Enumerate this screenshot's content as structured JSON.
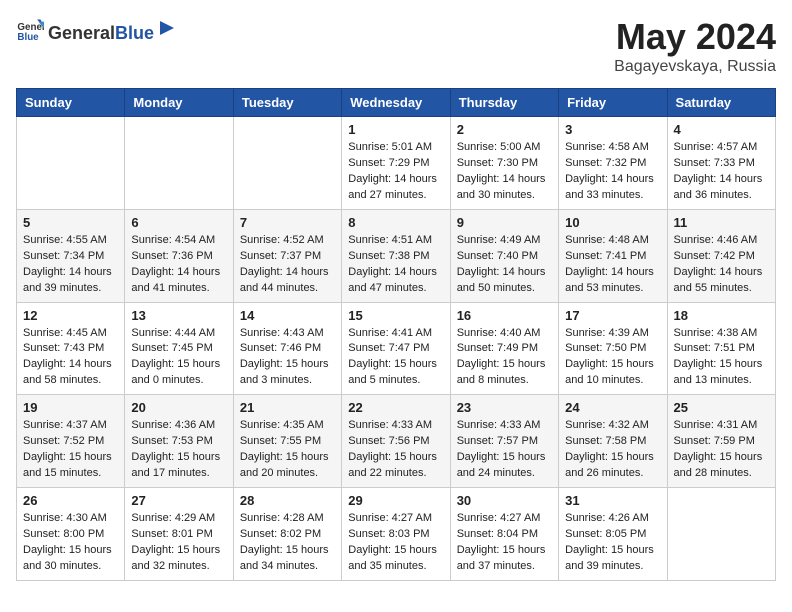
{
  "header": {
    "logo_general": "General",
    "logo_blue": "Blue",
    "title": "May 2024",
    "location": "Bagayevskaya, Russia"
  },
  "weekdays": [
    "Sunday",
    "Monday",
    "Tuesday",
    "Wednesday",
    "Thursday",
    "Friday",
    "Saturday"
  ],
  "weeks": [
    [
      {
        "day": "",
        "sunrise": "",
        "sunset": "",
        "daylight": ""
      },
      {
        "day": "",
        "sunrise": "",
        "sunset": "",
        "daylight": ""
      },
      {
        "day": "",
        "sunrise": "",
        "sunset": "",
        "daylight": ""
      },
      {
        "day": "1",
        "sunrise": "Sunrise: 5:01 AM",
        "sunset": "Sunset: 7:29 PM",
        "daylight": "Daylight: 14 hours and 27 minutes."
      },
      {
        "day": "2",
        "sunrise": "Sunrise: 5:00 AM",
        "sunset": "Sunset: 7:30 PM",
        "daylight": "Daylight: 14 hours and 30 minutes."
      },
      {
        "day": "3",
        "sunrise": "Sunrise: 4:58 AM",
        "sunset": "Sunset: 7:32 PM",
        "daylight": "Daylight: 14 hours and 33 minutes."
      },
      {
        "day": "4",
        "sunrise": "Sunrise: 4:57 AM",
        "sunset": "Sunset: 7:33 PM",
        "daylight": "Daylight: 14 hours and 36 minutes."
      }
    ],
    [
      {
        "day": "5",
        "sunrise": "Sunrise: 4:55 AM",
        "sunset": "Sunset: 7:34 PM",
        "daylight": "Daylight: 14 hours and 39 minutes."
      },
      {
        "day": "6",
        "sunrise": "Sunrise: 4:54 AM",
        "sunset": "Sunset: 7:36 PM",
        "daylight": "Daylight: 14 hours and 41 minutes."
      },
      {
        "day": "7",
        "sunrise": "Sunrise: 4:52 AM",
        "sunset": "Sunset: 7:37 PM",
        "daylight": "Daylight: 14 hours and 44 minutes."
      },
      {
        "day": "8",
        "sunrise": "Sunrise: 4:51 AM",
        "sunset": "Sunset: 7:38 PM",
        "daylight": "Daylight: 14 hours and 47 minutes."
      },
      {
        "day": "9",
        "sunrise": "Sunrise: 4:49 AM",
        "sunset": "Sunset: 7:40 PM",
        "daylight": "Daylight: 14 hours and 50 minutes."
      },
      {
        "day": "10",
        "sunrise": "Sunrise: 4:48 AM",
        "sunset": "Sunset: 7:41 PM",
        "daylight": "Daylight: 14 hours and 53 minutes."
      },
      {
        "day": "11",
        "sunrise": "Sunrise: 4:46 AM",
        "sunset": "Sunset: 7:42 PM",
        "daylight": "Daylight: 14 hours and 55 minutes."
      }
    ],
    [
      {
        "day": "12",
        "sunrise": "Sunrise: 4:45 AM",
        "sunset": "Sunset: 7:43 PM",
        "daylight": "Daylight: 14 hours and 58 minutes."
      },
      {
        "day": "13",
        "sunrise": "Sunrise: 4:44 AM",
        "sunset": "Sunset: 7:45 PM",
        "daylight": "Daylight: 15 hours and 0 minutes."
      },
      {
        "day": "14",
        "sunrise": "Sunrise: 4:43 AM",
        "sunset": "Sunset: 7:46 PM",
        "daylight": "Daylight: 15 hours and 3 minutes."
      },
      {
        "day": "15",
        "sunrise": "Sunrise: 4:41 AM",
        "sunset": "Sunset: 7:47 PM",
        "daylight": "Daylight: 15 hours and 5 minutes."
      },
      {
        "day": "16",
        "sunrise": "Sunrise: 4:40 AM",
        "sunset": "Sunset: 7:49 PM",
        "daylight": "Daylight: 15 hours and 8 minutes."
      },
      {
        "day": "17",
        "sunrise": "Sunrise: 4:39 AM",
        "sunset": "Sunset: 7:50 PM",
        "daylight": "Daylight: 15 hours and 10 minutes."
      },
      {
        "day": "18",
        "sunrise": "Sunrise: 4:38 AM",
        "sunset": "Sunset: 7:51 PM",
        "daylight": "Daylight: 15 hours and 13 minutes."
      }
    ],
    [
      {
        "day": "19",
        "sunrise": "Sunrise: 4:37 AM",
        "sunset": "Sunset: 7:52 PM",
        "daylight": "Daylight: 15 hours and 15 minutes."
      },
      {
        "day": "20",
        "sunrise": "Sunrise: 4:36 AM",
        "sunset": "Sunset: 7:53 PM",
        "daylight": "Daylight: 15 hours and 17 minutes."
      },
      {
        "day": "21",
        "sunrise": "Sunrise: 4:35 AM",
        "sunset": "Sunset: 7:55 PM",
        "daylight": "Daylight: 15 hours and 20 minutes."
      },
      {
        "day": "22",
        "sunrise": "Sunrise: 4:33 AM",
        "sunset": "Sunset: 7:56 PM",
        "daylight": "Daylight: 15 hours and 22 minutes."
      },
      {
        "day": "23",
        "sunrise": "Sunrise: 4:33 AM",
        "sunset": "Sunset: 7:57 PM",
        "daylight": "Daylight: 15 hours and 24 minutes."
      },
      {
        "day": "24",
        "sunrise": "Sunrise: 4:32 AM",
        "sunset": "Sunset: 7:58 PM",
        "daylight": "Daylight: 15 hours and 26 minutes."
      },
      {
        "day": "25",
        "sunrise": "Sunrise: 4:31 AM",
        "sunset": "Sunset: 7:59 PM",
        "daylight": "Daylight: 15 hours and 28 minutes."
      }
    ],
    [
      {
        "day": "26",
        "sunrise": "Sunrise: 4:30 AM",
        "sunset": "Sunset: 8:00 PM",
        "daylight": "Daylight: 15 hours and 30 minutes."
      },
      {
        "day": "27",
        "sunrise": "Sunrise: 4:29 AM",
        "sunset": "Sunset: 8:01 PM",
        "daylight": "Daylight: 15 hours and 32 minutes."
      },
      {
        "day": "28",
        "sunrise": "Sunrise: 4:28 AM",
        "sunset": "Sunset: 8:02 PM",
        "daylight": "Daylight: 15 hours and 34 minutes."
      },
      {
        "day": "29",
        "sunrise": "Sunrise: 4:27 AM",
        "sunset": "Sunset: 8:03 PM",
        "daylight": "Daylight: 15 hours and 35 minutes."
      },
      {
        "day": "30",
        "sunrise": "Sunrise: 4:27 AM",
        "sunset": "Sunset: 8:04 PM",
        "daylight": "Daylight: 15 hours and 37 minutes."
      },
      {
        "day": "31",
        "sunrise": "Sunrise: 4:26 AM",
        "sunset": "Sunset: 8:05 PM",
        "daylight": "Daylight: 15 hours and 39 minutes."
      },
      {
        "day": "",
        "sunrise": "",
        "sunset": "",
        "daylight": ""
      }
    ]
  ]
}
